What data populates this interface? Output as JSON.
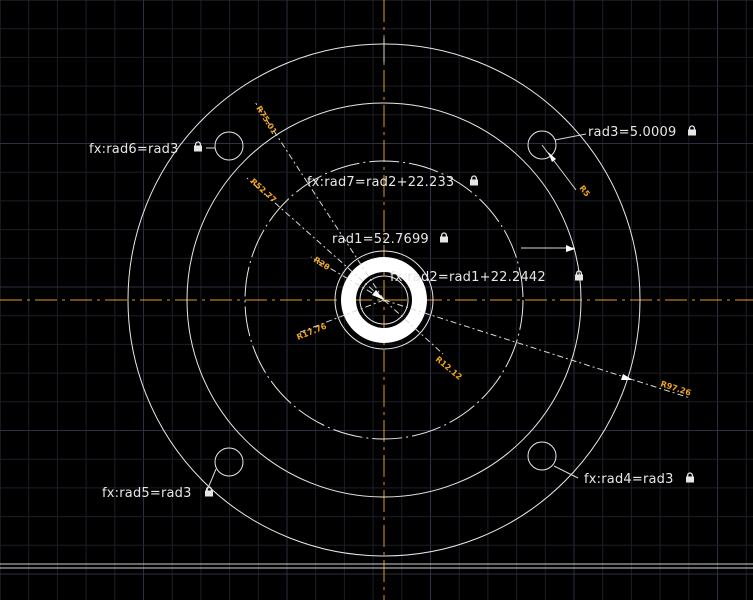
{
  "colors": {
    "background": "#000000",
    "grid_minor": "#1b1f27",
    "grid_major": "#2b3140",
    "geometry": "#e8e8e8",
    "centerline": "#e69a1a",
    "dimension": "#f2a51a"
  },
  "constraints": {
    "rad1": "rad1=52.7699",
    "rad2": "fx:rad2=rad1+22.2442",
    "rad3": "rad3=5.0009",
    "rad4": "fx:rad4=rad3",
    "rad5": "fx:rad5=rad3",
    "rad6": "fx:rad6=rad3",
    "rad7": "fx:rad7=rad2+22.233"
  },
  "dimensions": {
    "r75": "R75.01",
    "r52": "R52.77",
    "r20": "R20",
    "r17": "R17.76",
    "r12": "R12.12",
    "r97": "R97.26",
    "r5": "R5"
  },
  "icons": {
    "lock": "lock-icon"
  }
}
